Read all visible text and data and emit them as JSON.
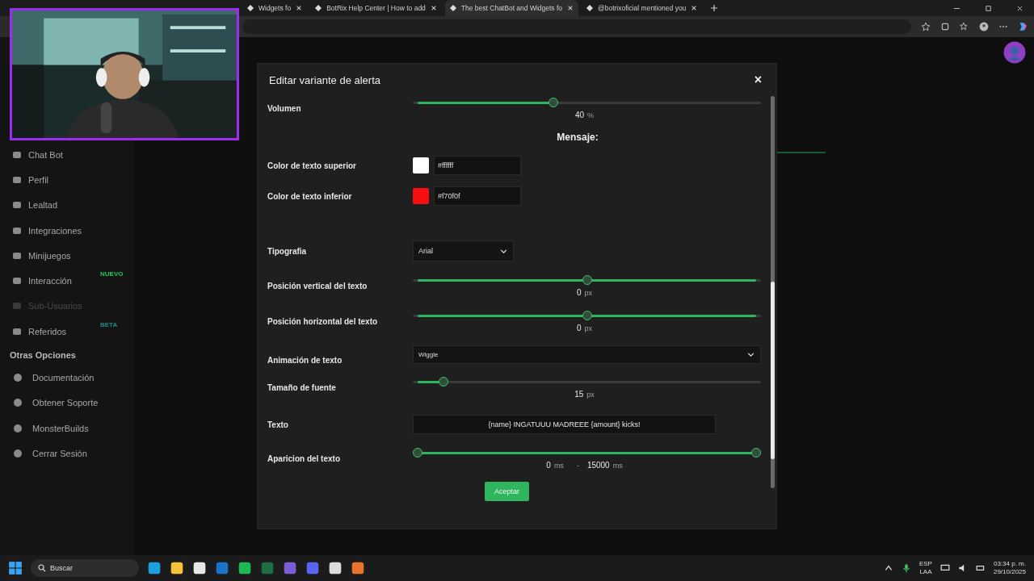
{
  "browser": {
    "tabs": [
      {
        "label": "Widgets fo",
        "selected": false
      },
      {
        "label": "BotRix Help Center | How to add",
        "selected": false
      },
      {
        "label": "The best ChatBot and Widgets fo",
        "selected": true
      },
      {
        "label": "@botrixoficial mentioned you",
        "selected": false
      }
    ]
  },
  "sidebar": {
    "items": [
      {
        "label": "Chat Bot",
        "disabled": false
      },
      {
        "label": "Perfil",
        "disabled": false
      },
      {
        "label": "Lealtad",
        "disabled": false
      },
      {
        "label": "Integraciones",
        "disabled": false
      },
      {
        "label": "Minijuegos",
        "disabled": false
      },
      {
        "label": "Interacción",
        "disabled": false,
        "badge": "NUEVO",
        "color": "#22c55e"
      },
      {
        "label": "Sub-Usuarios",
        "disabled": true
      },
      {
        "label": "Referidos",
        "disabled": false,
        "badge": "BETA",
        "color": "#1f8a8a"
      }
    ],
    "section_title": "Otras Opciones",
    "other_items": [
      {
        "label": "Documentación"
      },
      {
        "label": "Obtener Soporte"
      },
      {
        "label": "MonsterBuilds"
      },
      {
        "label": "Cerrar Sesión"
      }
    ]
  },
  "modal": {
    "title": "Editar variante de alerta",
    "close": "×",
    "rows": [
      {
        "kind": "slider",
        "label": "Volumen",
        "level": 0.4,
        "value": "40",
        "unit": "%"
      },
      {
        "kind": "heading",
        "label": "Mensaje:"
      },
      {
        "kind": "color",
        "label": "Color de texto superior",
        "color": "#ffffff",
        "value": "#ffffff"
      },
      {
        "kind": "color",
        "label": "Color de texto inferior",
        "color": "#f70f0f",
        "value": "#f70f0f"
      },
      {
        "kind": "font-select",
        "label": "Tipografia",
        "value": "Arial"
      },
      {
        "kind": "center-slider",
        "label": "Posición vertical del texto",
        "level": 0.5,
        "value": "0",
        "unit": "px"
      },
      {
        "kind": "center-slider",
        "label": "Posición horizontal del texto",
        "level": 0.5,
        "value": "0",
        "unit": "px"
      },
      {
        "kind": "select",
        "label": "Animación de texto",
        "value": "Wiggle"
      },
      {
        "kind": "slider",
        "label": "Tamaño de fuente",
        "level": 0.077,
        "value": "15",
        "unit": "px"
      },
      {
        "kind": "text",
        "label": "Texto",
        "value": "{name} INGATUUU MADREEE {amount} kicks!"
      },
      {
        "kind": "range",
        "label": "Aparicion del texto",
        "level": 1,
        "low": "0",
        "low_unit": "ms",
        "separator": "-",
        "high": "15000",
        "high_unit": "ms"
      }
    ],
    "button": "Aceptar"
  },
  "taskbar": {
    "search_placeholder": "Buscar",
    "language": "ESP",
    "layout": "LAA",
    "time": "03:34 p. m.",
    "date": "29/10/2025"
  }
}
